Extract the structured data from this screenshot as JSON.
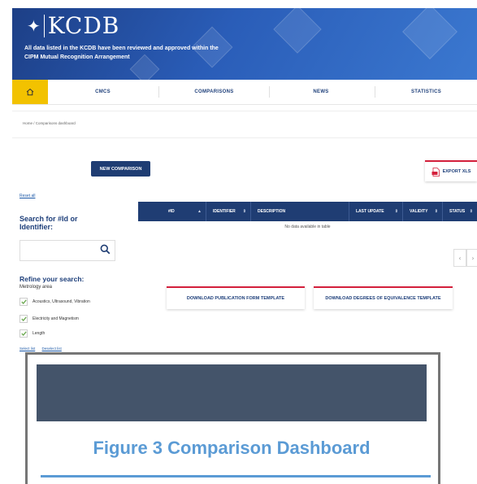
{
  "header": {
    "logo_text": "KCDB",
    "tagline_line1": "All data listed in the KCDB have been reviewed and approved within the",
    "tagline_line2": "CIPM Mutual Recognition Arrangement"
  },
  "nav": {
    "items": [
      "CMCS",
      "COMPARISONS",
      "NEWS",
      "STATISTICS"
    ],
    "home_color": "#f2c200"
  },
  "breadcrumb": "Home / Comparisons dashboard",
  "buttons": {
    "new_comparison": "NEW COMPARISON",
    "export_xls": "EXPORT XLS",
    "download_publication": "DOWNLOAD PUBLICATION FORM TEMPLATE",
    "download_degrees": "DOWNLOAD DEGREES OF EQUIVALENCE TEMPLATE"
  },
  "sidebar": {
    "reset": "Reset all",
    "search_title": "Search for #Id or Identifier:",
    "search_placeholder": "",
    "refine_title": "Refine your search:",
    "metrology_label": "Metrology area",
    "areas": [
      "Acoustics, Ultrasound, Vibration",
      "Electricity and Magnetism",
      "Length"
    ],
    "select_all": "Select list",
    "deselect_all": "Deselect list"
  },
  "table": {
    "columns": [
      "#ID",
      "IDENTIFIER",
      "DESCRIPTION",
      "LAST UPDATE",
      "VALIDITY",
      "STATUS"
    ],
    "empty_message": "No data available in table"
  },
  "figure": {
    "caption": "Figure 3 Comparison Dashboard"
  },
  "colors": {
    "navy": "#1f3d73",
    "accent_red": "#d4203c",
    "caption_blue": "#5b9bd5",
    "dark_block": "#44546a"
  }
}
